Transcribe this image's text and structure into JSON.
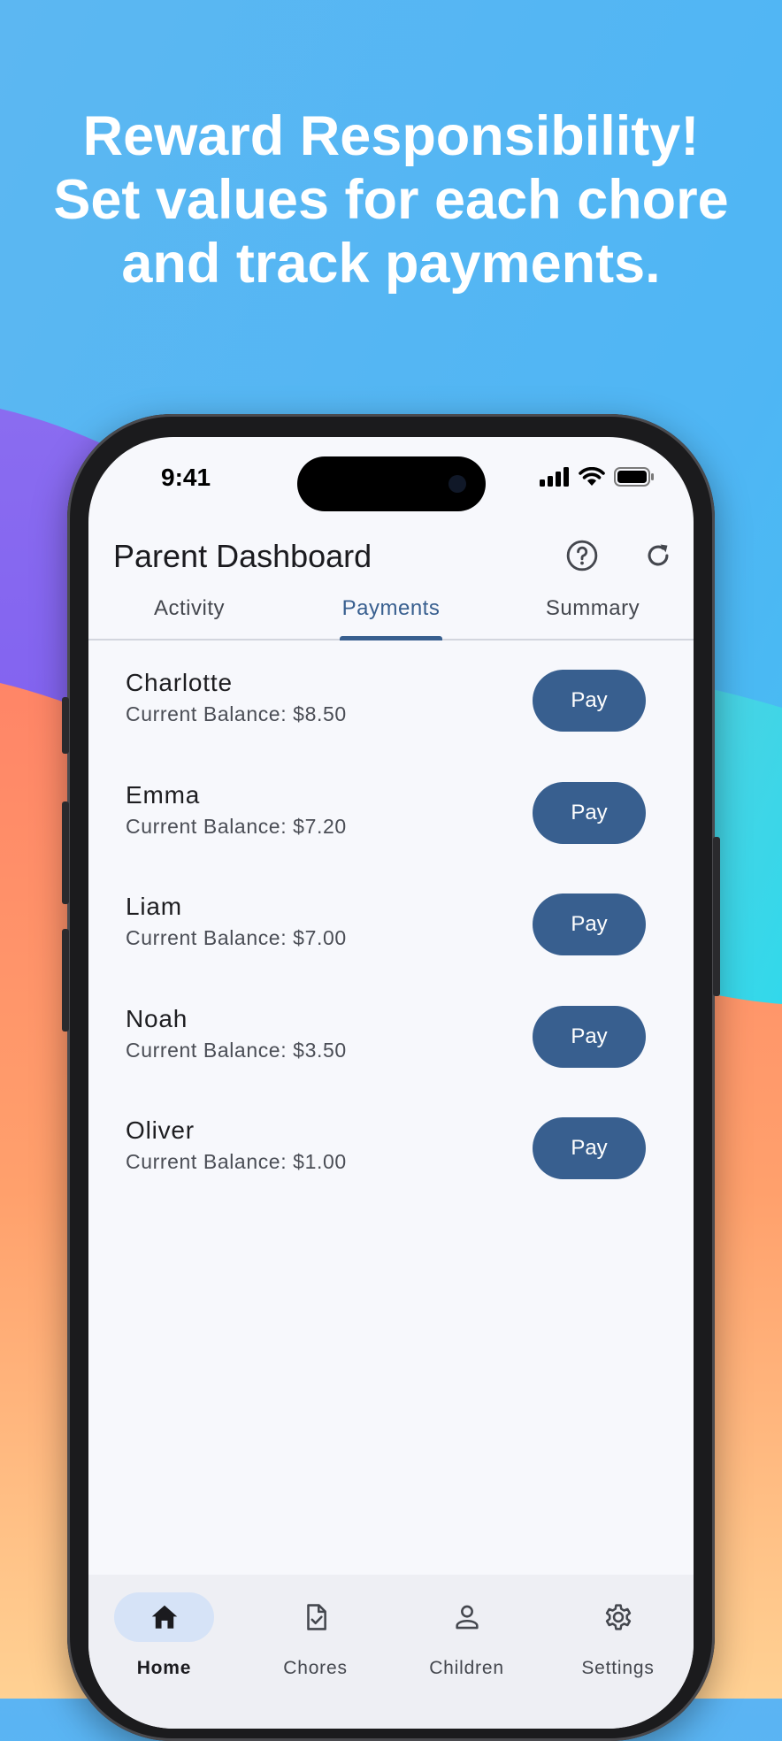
{
  "promo": {
    "line1": "Reward Responsibility!",
    "line2": "Set values for each chore",
    "line3": "and track payments."
  },
  "status_bar": {
    "time": "9:41",
    "icons": [
      "cellular-signal-icon",
      "wifi-icon",
      "battery-icon"
    ]
  },
  "app_bar": {
    "title": "Parent Dashboard",
    "icons": [
      "help-icon",
      "refresh-icon"
    ]
  },
  "tabs": [
    {
      "label": "Activity",
      "active": false
    },
    {
      "label": "Payments",
      "active": true
    },
    {
      "label": "Summary",
      "active": false
    }
  ],
  "children": [
    {
      "name": "Charlotte",
      "balance": "Current Balance: $8.50",
      "action": "Pay"
    },
    {
      "name": "Emma",
      "balance": "Current Balance: $7.20",
      "action": "Pay"
    },
    {
      "name": "Liam",
      "balance": "Current Balance: $7.00",
      "action": "Pay"
    },
    {
      "name": "Noah",
      "balance": "Current Balance: $3.50",
      "action": "Pay"
    },
    {
      "name": "Oliver",
      "balance": "Current Balance: $1.00",
      "action": "Pay"
    }
  ],
  "bottom_nav": [
    {
      "label": "Home",
      "icon": "home-icon",
      "active": true
    },
    {
      "label": "Chores",
      "icon": "chores-check-icon",
      "active": false
    },
    {
      "label": "Children",
      "icon": "person-icon",
      "active": false
    },
    {
      "label": "Settings",
      "icon": "gear-icon",
      "active": false
    }
  ],
  "colors": {
    "primary": "#385f8f",
    "screen_background": "#f7f8fc",
    "nav_background": "#eeeff4",
    "nav_active_pill": "#d6e3f7"
  }
}
